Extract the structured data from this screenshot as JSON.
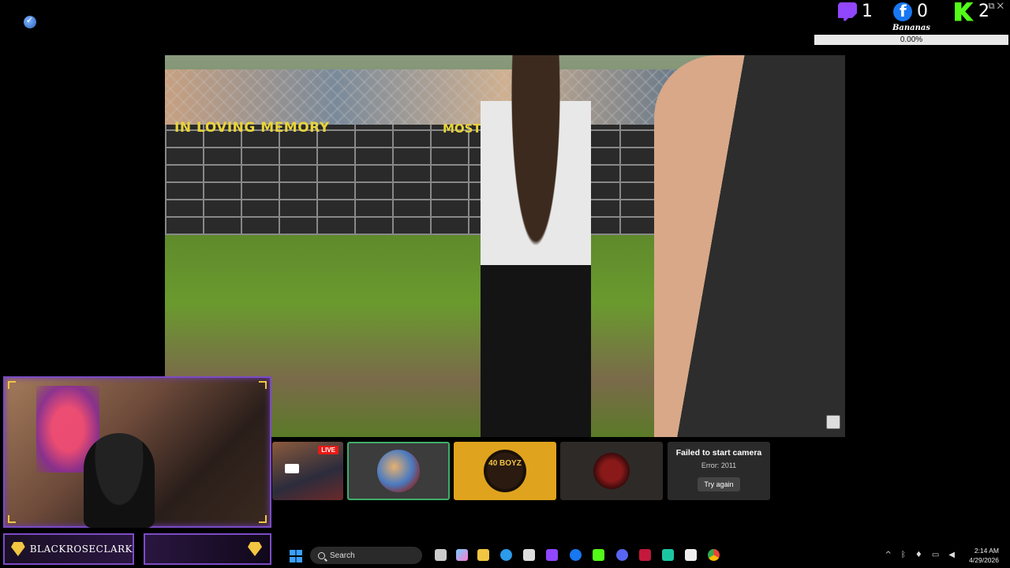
{
  "socials": {
    "twitch_count": "1",
    "facebook_count": "0",
    "kick_count": "2",
    "goal_label": "Bananas",
    "goal_percent": "0.00%",
    "goal_fraction": 0
  },
  "window": {
    "controls": "⧉ ✕"
  },
  "video": {
    "banner_left": "IN LOVING MEMORY",
    "banner_right": "MOSTWIN"
  },
  "streamer": {
    "name": "BLACKROSECLARK"
  },
  "thumbnails": {
    "live_badge": "LIVE",
    "t3_text": "40 BOYZ",
    "camera_error_title": "Failed to start camera",
    "camera_error_code": "Error: 2011",
    "try_again_label": "Try again"
  },
  "taskbar": {
    "search_label": "Search",
    "time": "2:14 AM",
    "date": "4/29/2026",
    "accent": "#3aa0ff"
  }
}
